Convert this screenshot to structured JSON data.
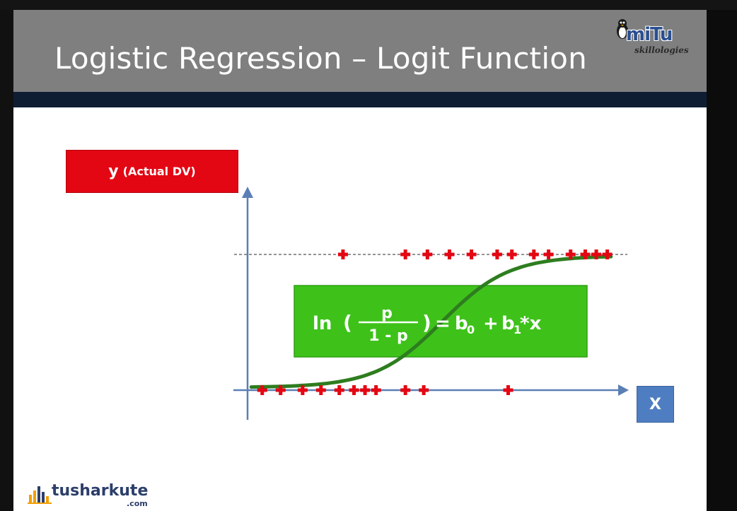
{
  "slide": {
    "title": "Logistic Regression – Logit Function"
  },
  "brand": {
    "logo_main": "miTu",
    "logo_sub": "skillologies",
    "footer_name": "tusharkute",
    "footer_domain": ".com"
  },
  "labels": {
    "y_main": "y",
    "y_paren": "(Actual DV)",
    "x": "X"
  },
  "formula": {
    "ln": "ln",
    "numerator": "p",
    "denominator": "1 - p",
    "rhs_b": "b",
    "rhs_sub0": "0",
    "rhs_plus": "+",
    "rhs_sub1": "1",
    "rhs_x": "*x"
  },
  "colors": {
    "title_band": "#7f7f7f",
    "dark_band": "#0f1d33",
    "y_box": "#e30613",
    "x_box": "#4f7dc1",
    "formula_box": "#3ec21a",
    "curve": "#2e7d1f",
    "axis": "#5b7fb5",
    "points": "#e30613"
  },
  "chart_data": {
    "type": "scatter",
    "series": [
      {
        "values_at_y1": [
          0.26,
          0.43,
          0.49,
          0.55,
          0.61,
          0.68,
          0.72,
          0.78,
          0.82,
          0.88,
          0.92,
          0.95,
          0.98
        ]
      },
      {
        "values_at_y0": [
          0.04,
          0.09,
          0.15,
          0.2,
          0.25,
          0.29,
          0.32,
          0.35,
          0.43,
          0.48,
          0.71
        ]
      }
    ],
    "curve": "sigmoid",
    "ylim": [
      0,
      1
    ],
    "xlim": [
      0,
      1
    ]
  }
}
